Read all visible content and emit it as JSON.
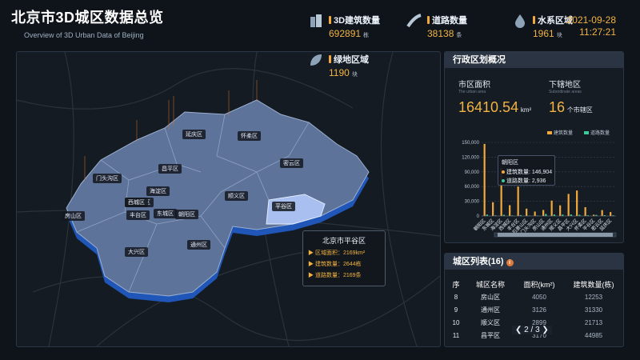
{
  "header": {
    "title": "北京市3D城区数据总览",
    "subtitle": "Overview of 3D Urban Data of Beijing"
  },
  "stats": [
    {
      "label": "3D建筑数量",
      "value": "692891",
      "unit": "栋"
    },
    {
      "label": "道路数量",
      "value": "38138",
      "unit": "条"
    },
    {
      "label": "水系区域",
      "value": "1961",
      "unit": "块"
    },
    {
      "label": "绿地区域",
      "value": "1190",
      "unit": "块"
    }
  ],
  "datetime": {
    "date": "2021-09-28",
    "time": "11:27:21"
  },
  "map": {
    "districts": [
      "延庆区",
      "怀柔区",
      "密云区",
      "昌平区",
      "门头沟区",
      "海淀区",
      "顺义区",
      "平谷区",
      "石景山区",
      "丰台区",
      "朝阳区",
      "东城区",
      "西城区",
      "房山区",
      "大兴区",
      "通州区"
    ],
    "highlighted": "平谷区",
    "tooltip": {
      "title": "北京市平谷区",
      "rows": [
        "区域面积：2169km²",
        "建筑数量：2644栋",
        "道路数量：2169条"
      ]
    }
  },
  "admin_panel": {
    "title": "行政区划概况",
    "area_label": "市区面积",
    "area_sub": "The urban area",
    "area_value": "16410.54",
    "area_unit": "km²",
    "districts_label": "下辖地区",
    "districts_sub": "Subordinate areas",
    "districts_value": "16",
    "districts_unit": "个市辖区",
    "tooltip": {
      "title": "朝阳区",
      "rows": [
        "建筑数量: 146,904",
        "道路数量: 2,936"
      ]
    }
  },
  "chart_data": {
    "type": "bar",
    "categories": [
      "朝阳区",
      "东城区",
      "海淀区",
      "西城区",
      "丰台区",
      "石景山区",
      "门头沟区",
      "房山区",
      "通州区",
      "顺义区",
      "昌平区",
      "大兴区",
      "怀柔区",
      "平谷区",
      "密云区",
      "延庆区"
    ],
    "series": [
      {
        "name": "建筑数量",
        "color": "#f2a93b",
        "values": [
          146904,
          28000,
          98000,
          22000,
          60000,
          15000,
          9000,
          12253,
          31330,
          21713,
          44985,
          52000,
          18000,
          2644,
          12000,
          8000
        ]
      },
      {
        "name": "道路数量",
        "color": "#3fc99a",
        "values": [
          2936,
          1200,
          2500,
          1100,
          1800,
          700,
          800,
          4050,
          3126,
          2899,
          3170,
          2400,
          1500,
          2169,
          1600,
          1300
        ]
      }
    ],
    "yticks": [
      "0",
      "30,000",
      "60,000",
      "90,000",
      "120,000",
      "150,000"
    ],
    "ylim": [
      0,
      150000
    ],
    "legend": "top-right"
  },
  "district_table": {
    "title": "城区列表(16)",
    "columns": [
      "序",
      "城区名称",
      "面积(km²)",
      "建筑数量(栋)"
    ],
    "rows": [
      [
        "8",
        "房山区",
        "4050",
        "12253"
      ],
      [
        "9",
        "通州区",
        "3126",
        "31330"
      ],
      [
        "10",
        "顺义区",
        "2899",
        "21713"
      ],
      [
        "11",
        "昌平区",
        "3170",
        "44985"
      ]
    ],
    "pager": "2 / 3"
  }
}
